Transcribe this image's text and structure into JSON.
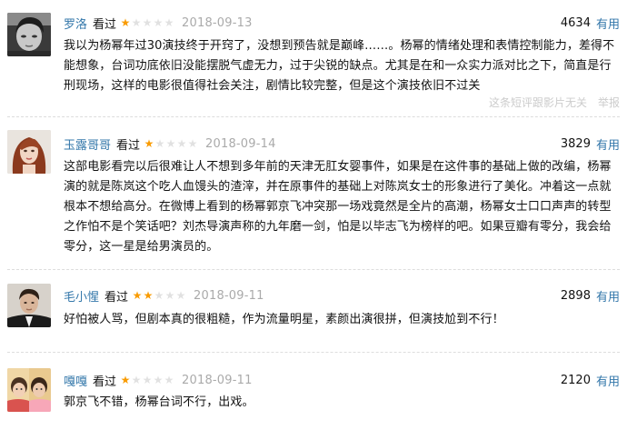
{
  "star_on": "★",
  "star_off": "★",
  "reviews": [
    {
      "username": "罗洛",
      "status": "看过",
      "stars": 1,
      "date": "2018-09-13",
      "useful_count": "4634",
      "useful_label": "有用",
      "avatar": "dark-haired-man-avatar",
      "content": "我以为杨幂年过30演技终于开窍了，没想到预告就是巅峰……。杨幂的情绪处理和表情控制能力，差得不能想象，台词功底依旧没能摆脱气虚无力，过于尖锐的缺点。尤其是在和一众实力派对比之下，简直是行刑现场，这样的电影很值得社会关注，剧情比较完整，但是这个演技依旧不过关",
      "footer_links": [
        "这条短评跟影片无关",
        "举报"
      ]
    },
    {
      "username": "玉露哥哥",
      "status": "看过",
      "stars": 1,
      "date": "2018-09-14",
      "useful_count": "3829",
      "useful_label": "有用",
      "avatar": "red-haired-woman-avatar",
      "content": "这部电影看完以后很难让人不想到多年前的天津无肛女婴事件，如果是在这件事的基础上做的改编，杨幂演的就是陈岚这个吃人血馒头的渣滓，并在原事件的基础上对陈岚女士的形象进行了美化。冲着这一点就根本不想给高分。在微博上看到的杨幂郭京飞冲突那一场戏竟然是全片的高潮，杨幂女士口口声声的转型之作怕不是个笑话吧？刘杰导演声称的九年磨一剑，怕是以毕志飞为榜样的吧。如果豆瓣有零分，我会给零分，这一星是给男演员的。"
    },
    {
      "username": "毛小惺",
      "status": "看过",
      "stars": 2,
      "date": "2018-09-11",
      "useful_count": "2898",
      "useful_label": "有用",
      "avatar": "man-in-suit-avatar",
      "content": "好怕被人骂，但剧本真的很粗糙，作为流量明星，素颜出演很拼，但演技尬到不行！"
    },
    {
      "username": "嘎嘎",
      "status": "看过",
      "stars": 1,
      "date": "2018-09-11",
      "useful_count": "2120",
      "useful_label": "有用",
      "avatar": "two-children-avatar",
      "content": "郭京飞不错，杨幂台词不行，出戏。"
    }
  ]
}
